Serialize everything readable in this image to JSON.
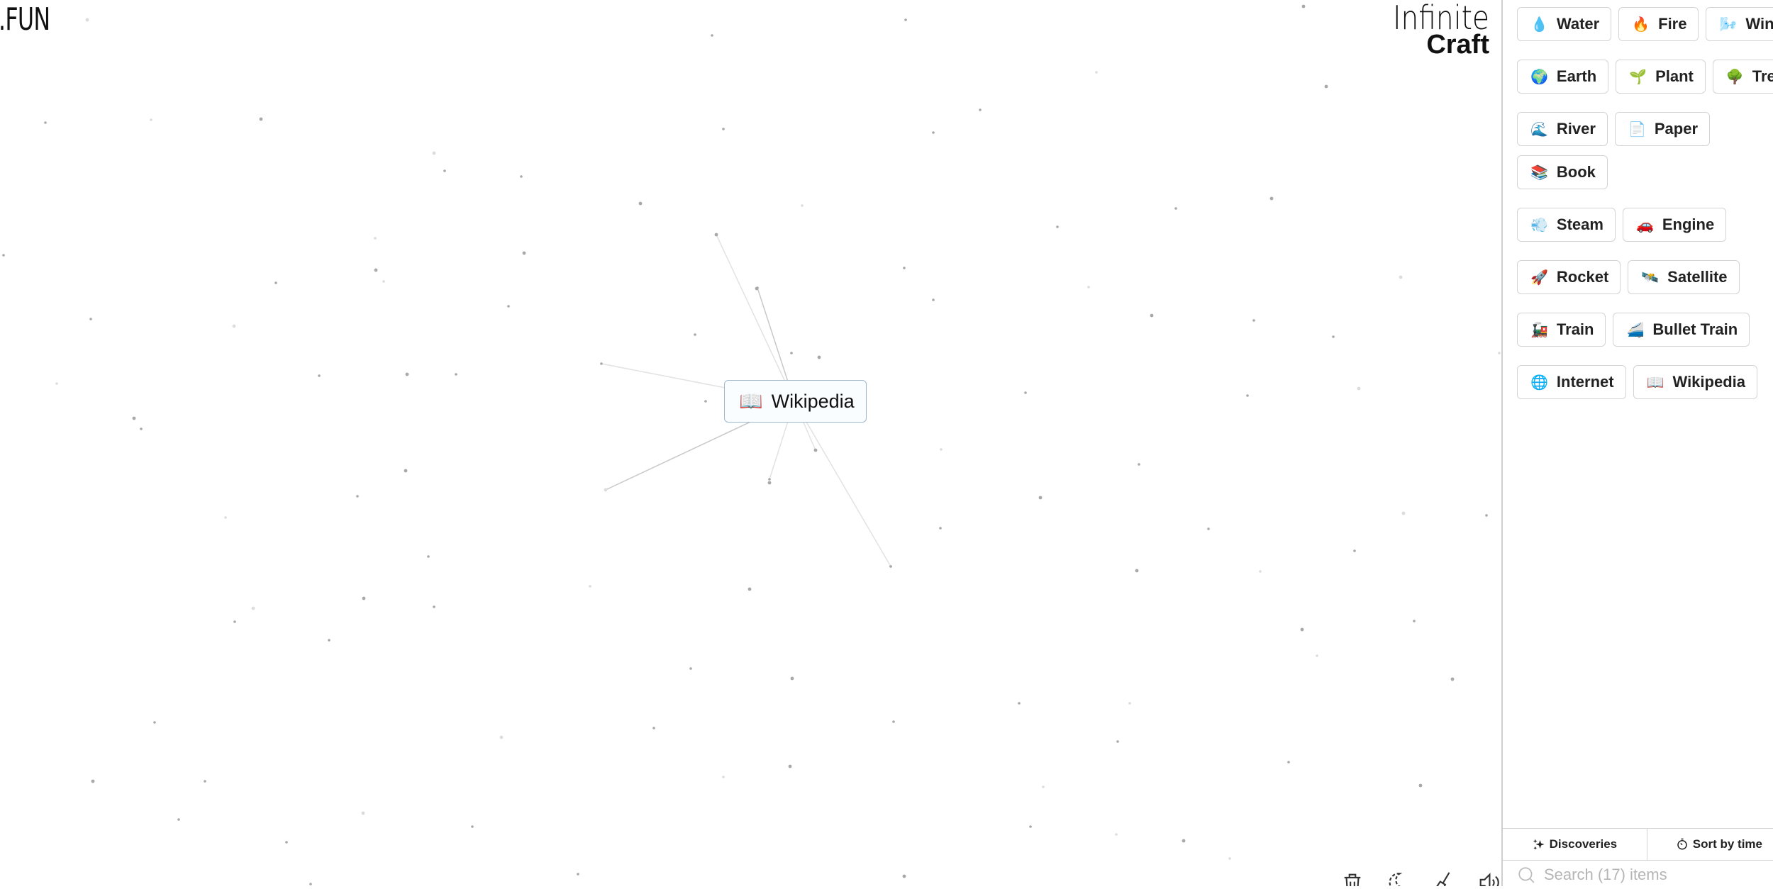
{
  "branding": {
    "left_logo": ".FUN",
    "right_logo_line1": "Infinite",
    "right_logo_line2": "Craft"
  },
  "canvas": {
    "placed_items": [
      {
        "emoji": "📖",
        "icon": "open-book-icon",
        "label": "Wikipedia"
      }
    ]
  },
  "toolbar": {
    "tools": [
      {
        "name": "clear-trash-icon"
      },
      {
        "name": "dark-mode-icon"
      },
      {
        "name": "brush-icon"
      },
      {
        "name": "sound-icon"
      }
    ]
  },
  "sidebar": {
    "items": [
      {
        "emoji": "💧",
        "icon": "droplet-icon",
        "label": "Water"
      },
      {
        "emoji": "🔥",
        "icon": "fire-icon",
        "label": "Fire"
      },
      {
        "emoji": "🌬️",
        "icon": "wind-icon",
        "label": "Wind"
      },
      {
        "emoji": "🌍",
        "icon": "earth-globe-icon",
        "label": "Earth"
      },
      {
        "emoji": "🌱",
        "icon": "seedling-icon",
        "label": "Plant"
      },
      {
        "emoji": "🌳",
        "icon": "tree-icon",
        "label": "Tree"
      },
      {
        "emoji": "🌊",
        "icon": "wave-icon",
        "label": "River"
      },
      {
        "emoji": "📄",
        "icon": "paper-icon",
        "label": "Paper"
      },
      {
        "emoji": "📚",
        "icon": "books-icon",
        "label": "Book"
      },
      {
        "emoji": "💨",
        "icon": "steam-icon",
        "label": "Steam"
      },
      {
        "emoji": "🚗",
        "icon": "car-icon",
        "label": "Engine"
      },
      {
        "emoji": "🚀",
        "icon": "rocket-icon",
        "label": "Rocket"
      },
      {
        "emoji": "🛰️",
        "icon": "satellite-icon",
        "label": "Satellite"
      },
      {
        "emoji": "🚂",
        "icon": "locomotive-icon",
        "label": "Train"
      },
      {
        "emoji": "🚄",
        "icon": "bullet-train-icon",
        "label": "Bullet Train"
      },
      {
        "emoji": "🌐",
        "icon": "globe-meridians-icon",
        "label": "Internet"
      },
      {
        "emoji": "📖",
        "icon": "open-book-icon",
        "label": "Wikipedia"
      }
    ],
    "discoveries_label": "Discoveries",
    "sort_label": "Sort by time",
    "search_placeholder": "Search (17) items"
  }
}
